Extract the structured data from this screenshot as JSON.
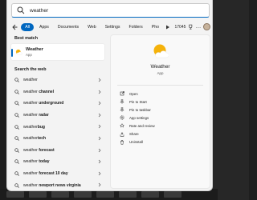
{
  "search": {
    "query": "weather"
  },
  "filters": {
    "tabs": [
      {
        "label": "All",
        "active": true
      },
      {
        "label": "Apps"
      },
      {
        "label": "Documents"
      },
      {
        "label": "Web"
      },
      {
        "label": "Settings"
      },
      {
        "label": "Folders"
      },
      {
        "label": "Pho"
      }
    ],
    "points": "17045",
    "more": "..."
  },
  "best_match": {
    "title": "Best match",
    "name": "Weather",
    "kind": "App"
  },
  "web": {
    "title": "Search the web",
    "items": [
      {
        "prefix": "weather",
        "suffix": ""
      },
      {
        "prefix": "weather ",
        "suffix": "channel"
      },
      {
        "prefix": "weather ",
        "suffix": "underground"
      },
      {
        "prefix": "weather ",
        "suffix": "radar"
      },
      {
        "prefix": "weather",
        "suffix": "bug"
      },
      {
        "prefix": "weather",
        "suffix": "tech"
      },
      {
        "prefix": "weather ",
        "suffix": "forecast"
      },
      {
        "prefix": "weather ",
        "suffix": "today"
      },
      {
        "prefix": "weather ",
        "suffix": "forecast 10 day"
      },
      {
        "prefix": "weather ",
        "suffix": "newport news virginia"
      }
    ]
  },
  "details": {
    "name": "Weather",
    "kind": "App",
    "actions": [
      {
        "label": "Open",
        "icon": "open-icon"
      },
      {
        "label": "Pin to Start",
        "icon": "pin-icon"
      },
      {
        "label": "Pin to taskbar",
        "icon": "pin-taskbar-icon"
      },
      {
        "label": "App settings",
        "icon": "gear-icon"
      },
      {
        "label": "Rate and review",
        "icon": "star-icon"
      },
      {
        "label": "Share",
        "icon": "share-icon"
      },
      {
        "label": "Uninstall",
        "icon": "trash-icon"
      }
    ]
  },
  "colors": {
    "accent": "#0067c0",
    "sun": "#f5b20a",
    "cloud": "#ffffff"
  }
}
